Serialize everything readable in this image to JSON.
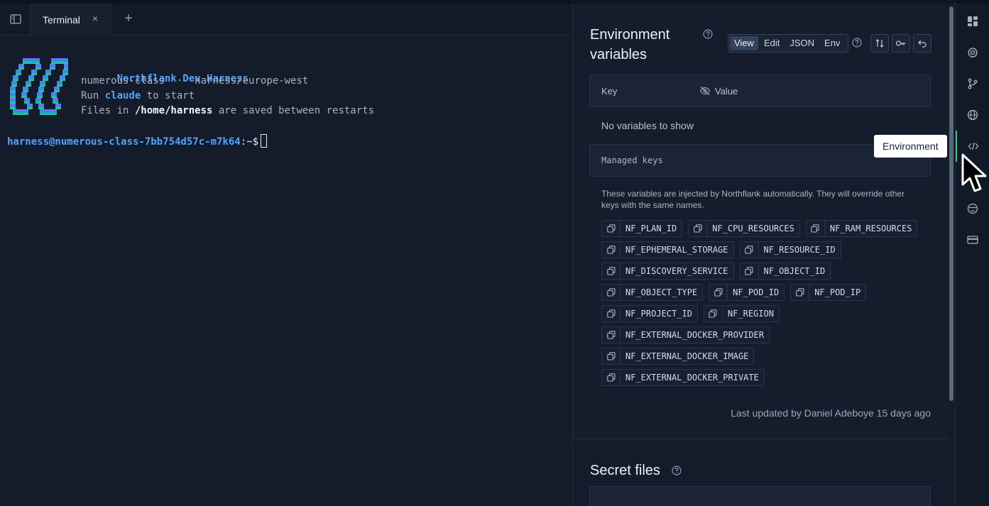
{
  "tabbar": {
    "tab_label": "Terminal",
    "close_glyph": "×",
    "add_glyph": "+"
  },
  "terminal": {
    "banner_title": "Northflank Dev Harness",
    "banner_instance": "numerous-class",
    "banner_sep": "·",
    "banner_region": "harness/europe-west",
    "run_prefix": "Run ",
    "run_command": "claude",
    "run_suffix": " to start",
    "files_prefix": "Files in ",
    "files_path": "/home/harness",
    "files_suffix": " are saved between restarts",
    "prompt_user": "harness@numerous-class-7bb754d57c-m7k64",
    "prompt_path": ":~$"
  },
  "env": {
    "title": "Environment variables",
    "modes": [
      "View",
      "Edit",
      "JSON",
      "Env"
    ],
    "active_mode": "View",
    "table_key_header": "Key",
    "table_value_header": "Value",
    "empty_message": "No variables to show",
    "managed_label": "Managed keys",
    "managed_description": "These variables are injected by Northflank automatically. They will override other keys with the same names.",
    "managed_rows": [
      [
        "NF_PLAN_ID",
        "NF_CPU_RESOURCES",
        "NF_RAM_RESOURCES"
      ],
      [
        "NF_EPHEMERAL_STORAGE",
        "NF_RESOURCE_ID"
      ],
      [
        "NF_DISCOVERY_SERVICE",
        "NF_OBJECT_ID"
      ],
      [
        "NF_OBJECT_TYPE",
        "NF_POD_ID",
        "NF_POD_IP"
      ],
      [
        "NF_PROJECT_ID",
        "NF_REGION"
      ],
      [
        "NF_EXTERNAL_DOCKER_PROVIDER"
      ],
      [
        "NF_EXTERNAL_DOCKER_IMAGE"
      ],
      [
        "NF_EXTERNAL_DOCKER_PRIVATE"
      ]
    ],
    "last_updated": "Last updated by Daniel Adeboye 15 days ago"
  },
  "secret_files": {
    "title": "Secret files"
  },
  "rail": {
    "items": [
      "dashboard-icon",
      "gear-icon",
      "git-branch-icon",
      "globe-icon",
      "code-icon",
      "face-icon",
      "card-icon"
    ],
    "active": "code-icon"
  },
  "tooltip": {
    "text": "Environment"
  },
  "colors": {
    "accent_green": "#2fc684",
    "accent_blue": "#4da3ff",
    "background": "#141c2b"
  }
}
